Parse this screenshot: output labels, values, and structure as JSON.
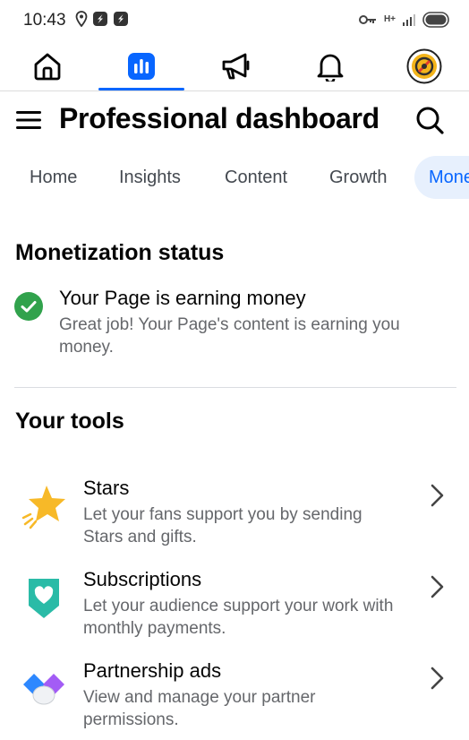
{
  "status_bar": {
    "time": "10:43",
    "icons_left": [
      "location-icon",
      "app-notification-icon",
      "app-notification-icon"
    ],
    "icons_right": [
      "vpn-key-icon",
      "hplus-data-icon",
      "signal-icon",
      "battery-icon"
    ],
    "network_label": "H+"
  },
  "nav": {
    "items": [
      {
        "name": "home-icon",
        "active": false
      },
      {
        "name": "dashboard-icon",
        "active": true
      },
      {
        "name": "megaphone-icon",
        "active": false
      },
      {
        "name": "bell-icon",
        "active": false
      },
      {
        "name": "profile-avatar",
        "active": false
      }
    ],
    "accent": "#0866ff"
  },
  "header": {
    "title": "Professional dashboard"
  },
  "tabs": [
    "Home",
    "Insights",
    "Content",
    "Growth",
    "Mone"
  ],
  "active_tab": "Mone",
  "monetization": {
    "section_title": "Monetization status",
    "heading": "Your Page is earning money",
    "description": "Great job! Your Page's content is earning you money.",
    "status_color": "#31a24c"
  },
  "tools": {
    "section_title": "Your tools",
    "items": [
      {
        "name": "Stars",
        "description": "Let your fans support you by sending Stars and gifts.",
        "icon": "star-icon"
      },
      {
        "name": "Subscriptions",
        "description": "Let your audience support your work with monthly payments.",
        "icon": "heart-badge-icon"
      },
      {
        "name": "Partnership ads",
        "description": "View and manage your partner permissions.",
        "icon": "partnership-icon"
      }
    ]
  }
}
